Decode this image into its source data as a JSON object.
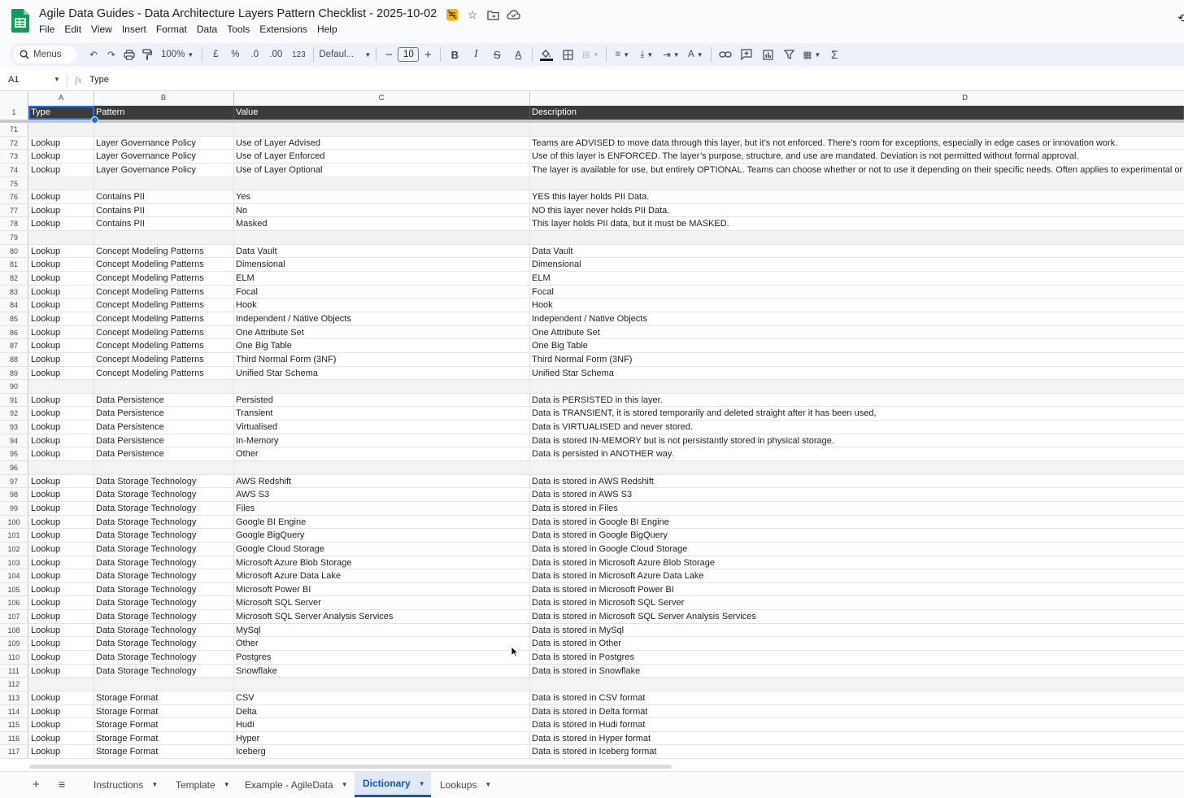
{
  "document": {
    "title": "Agile Data Guides - Data Architecture Layers Pattern Checklist - 2025-10-02",
    "menu": [
      "File",
      "Edit",
      "View",
      "Insert",
      "Format",
      "Data",
      "Tools",
      "Extensions",
      "Help"
    ]
  },
  "toolbar": {
    "search_label": "Menus",
    "zoom": "100%",
    "currency": "£",
    "percent": "%",
    "decrease_decimal": ".0",
    "increase_decimal": ".00",
    "number_format": "123",
    "font_family": "Defaul...",
    "font_size": "10"
  },
  "formula_bar": {
    "cell_ref": "A1",
    "content": "Type"
  },
  "columns": [
    "A",
    "B",
    "C",
    "D"
  ],
  "header_row": {
    "num": "1",
    "cells": [
      "Type",
      "Pattern",
      "Value",
      "Description"
    ]
  },
  "rows": [
    {
      "n": "71",
      "c": [
        "",
        "",
        "",
        ""
      ]
    },
    {
      "n": "72",
      "c": [
        "Lookup",
        "Layer Governance Policy",
        "Use of Layer Advised",
        "Teams are ADVISED to move data through this layer, but it’s not enforced. There’s room for exceptions, especially in edge cases or innovation work."
      ]
    },
    {
      "n": "73",
      "c": [
        "Lookup",
        "Layer Governance Policy",
        "Use of Layer Enforced",
        "Use of this layer is ENFORCED. The layer’s purpose, structure, and use are mandated. Deviation is not permitted without formal approval."
      ]
    },
    {
      "n": "74",
      "c": [
        "Lookup",
        "Layer Governance Policy",
        "Use of Layer Optional",
        "The layer is available for use, but entirely OPTIONAL. Teams can choose whether or not to use it depending on their specific needs. Often applies to experimental or transiti"
      ]
    },
    {
      "n": "75",
      "c": [
        "",
        "",
        "",
        ""
      ]
    },
    {
      "n": "76",
      "c": [
        "Lookup",
        "Contains PII",
        "Yes",
        "YES this layer holds PII Data."
      ]
    },
    {
      "n": "77",
      "c": [
        "Lookup",
        "Contains PII",
        "No",
        "NO this layer never holds PII Data."
      ]
    },
    {
      "n": "78",
      "c": [
        "Lookup",
        "Contains PII",
        "Masked",
        "This layer holds PII data, but it must be MASKED."
      ]
    },
    {
      "n": "79",
      "c": [
        "",
        "",
        "",
        ""
      ]
    },
    {
      "n": "80",
      "c": [
        "Lookup",
        "Concept Modeling Patterns",
        "Data Vault",
        "Data Vault"
      ]
    },
    {
      "n": "81",
      "c": [
        "Lookup",
        "Concept Modeling Patterns",
        "Dimensional",
        "Dimensional"
      ]
    },
    {
      "n": "82",
      "c": [
        "Lookup",
        "Concept Modeling Patterns",
        "ELM",
        "ELM"
      ]
    },
    {
      "n": "83",
      "c": [
        "Lookup",
        "Concept Modeling Patterns",
        "Focal",
        "Focal"
      ]
    },
    {
      "n": "84",
      "c": [
        "Lookup",
        "Concept Modeling Patterns",
        "Hook",
        "Hook"
      ]
    },
    {
      "n": "85",
      "c": [
        "Lookup",
        "Concept Modeling Patterns",
        "Independent / Native Objects",
        "Independent / Native Objects"
      ]
    },
    {
      "n": "86",
      "c": [
        "Lookup",
        "Concept Modeling Patterns",
        "One Attribute Set",
        "One Attribute Set"
      ]
    },
    {
      "n": "87",
      "c": [
        "Lookup",
        "Concept Modeling Patterns",
        "One Big Table",
        "One Big Table"
      ]
    },
    {
      "n": "88",
      "c": [
        "Lookup",
        "Concept Modeling Patterns",
        "Third Normal Form (3NF)",
        "Third Normal Form (3NF)"
      ]
    },
    {
      "n": "89",
      "c": [
        "Lookup",
        "Concept Modeling Patterns",
        "Unified Star Schema",
        "Unified Star Schema"
      ]
    },
    {
      "n": "90",
      "c": [
        "",
        "",
        "",
        ""
      ]
    },
    {
      "n": "91",
      "c": [
        "Lookup",
        "Data Persistence",
        "Persisted",
        "Data is PERSISTED in this layer."
      ]
    },
    {
      "n": "92",
      "c": [
        "Lookup",
        "Data Persistence",
        "Transient",
        "Data is TRANSIENT, it is stored temporarily and deleted straight after it has been used,"
      ]
    },
    {
      "n": "93",
      "c": [
        "Lookup",
        "Data Persistence",
        "Virtualised",
        "Data is VIRTUALISED and never stored."
      ]
    },
    {
      "n": "94",
      "c": [
        "Lookup",
        "Data Persistence",
        "In-Memory",
        "Data is stored IN-MEMORY but is not persistantly stored in physical storage."
      ]
    },
    {
      "n": "95",
      "c": [
        "Lookup",
        "Data Persistence",
        "Other",
        "Data is persisted in ANOTHER way."
      ]
    },
    {
      "n": "96",
      "c": [
        "",
        "",
        "",
        ""
      ]
    },
    {
      "n": "97",
      "c": [
        "Lookup",
        "Data Storage Technology",
        "AWS Redshift",
        "Data is stored in AWS Redshift"
      ]
    },
    {
      "n": "98",
      "c": [
        "Lookup",
        "Data Storage Technology",
        "AWS S3",
        "Data is stored in AWS S3"
      ]
    },
    {
      "n": "99",
      "c": [
        "Lookup",
        "Data Storage Technology",
        "Files",
        "Data is stored in Files"
      ]
    },
    {
      "n": "100",
      "c": [
        "Lookup",
        "Data Storage Technology",
        "Google BI Engine",
        "Data is stored in Google BI Engine"
      ]
    },
    {
      "n": "101",
      "c": [
        "Lookup",
        "Data Storage Technology",
        "Google BigQuery",
        "Data is stored in Google BigQuery"
      ]
    },
    {
      "n": "102",
      "c": [
        "Lookup",
        "Data Storage Technology",
        "Google Cloud Storage",
        "Data is stored in Google Cloud Storage"
      ]
    },
    {
      "n": "103",
      "c": [
        "Lookup",
        "Data Storage Technology",
        "Microsoft Azure Blob Storage",
        "Data is stored in Microsoft Azure Blob Storage"
      ]
    },
    {
      "n": "104",
      "c": [
        "Lookup",
        "Data Storage Technology",
        "Microsoft Azure Data Lake",
        "Data is stored in Microsoft Azure Data Lake"
      ]
    },
    {
      "n": "105",
      "c": [
        "Lookup",
        "Data Storage Technology",
        "Microsoft Power BI",
        "Data is stored in Microsoft Power BI"
      ]
    },
    {
      "n": "106",
      "c": [
        "Lookup",
        "Data Storage Technology",
        "Microsoft SQL Server",
        "Data is stored in Microsoft SQL Server"
      ]
    },
    {
      "n": "107",
      "c": [
        "Lookup",
        "Data Storage Technology",
        "Microsoft SQL Server Analysis Services",
        "Data is stored in Microsoft SQL Server Analysis Services"
      ]
    },
    {
      "n": "108",
      "c": [
        "Lookup",
        "Data Storage Technology",
        "MySql",
        "Data is stored in MySql"
      ]
    },
    {
      "n": "109",
      "c": [
        "Lookup",
        "Data Storage Technology",
        "Other",
        "Data is stored in Other"
      ]
    },
    {
      "n": "110",
      "c": [
        "Lookup",
        "Data Storage Technology",
        "Postgres",
        "Data is stored in Postgres"
      ]
    },
    {
      "n": "111",
      "c": [
        "Lookup",
        "Data Storage Technology",
        "Snowflake",
        "Data is stored in Snowflake"
      ]
    },
    {
      "n": "112",
      "c": [
        "",
        "",
        "",
        ""
      ]
    },
    {
      "n": "113",
      "c": [
        "Lookup",
        "Storage Format",
        "CSV",
        "Data is stored in CSV format"
      ]
    },
    {
      "n": "114",
      "c": [
        "Lookup",
        "Storage Format",
        "Delta",
        "Data is stored in Delta format"
      ]
    },
    {
      "n": "115",
      "c": [
        "Lookup",
        "Storage Format",
        "Hudi",
        "Data is stored in Hudi format"
      ]
    },
    {
      "n": "116",
      "c": [
        "Lookup",
        "Storage Format",
        "Hyper",
        "Data is stored in Hyper format"
      ]
    },
    {
      "n": "117",
      "c": [
        "Lookup",
        "Storage Format",
        "Iceberg",
        "Data is stored in Iceberg format"
      ]
    }
  ],
  "sheet_tabs": [
    {
      "label": "Instructions",
      "active": false
    },
    {
      "label": "Template",
      "active": false
    },
    {
      "label": "Example - AgileData",
      "active": false
    },
    {
      "label": "Dictionary",
      "active": true
    },
    {
      "label": "Lookups",
      "active": false
    }
  ],
  "colors": {
    "app_green": "#0f9d58",
    "header_row_bg": "#3b3b3b",
    "selection_blue": "#1a73e8",
    "active_tab_text": "#0b57d0"
  }
}
